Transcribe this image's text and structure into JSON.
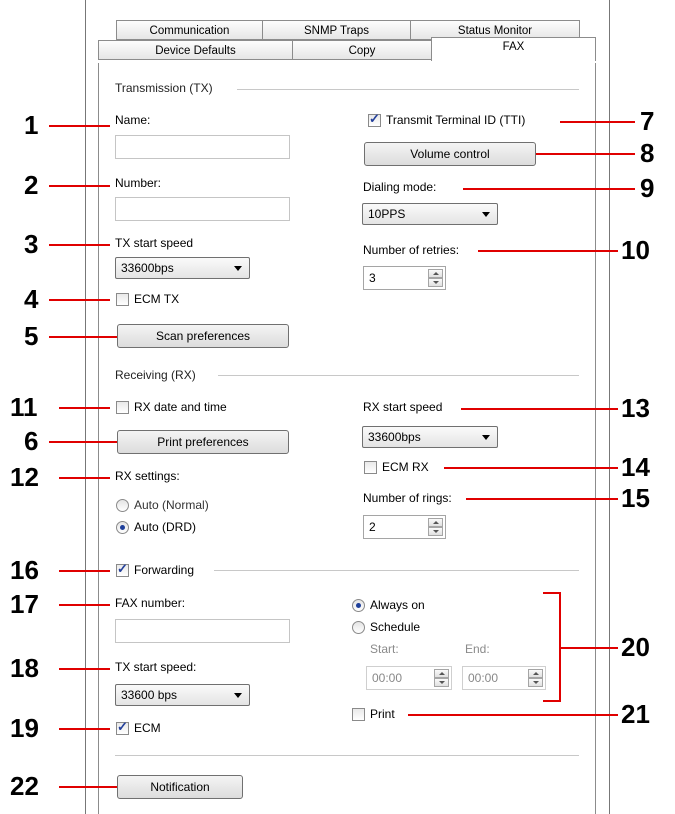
{
  "tabs": {
    "row1": [
      "Communication",
      "SNMP Traps",
      "Status Monitor"
    ],
    "row2": [
      "Device Defaults",
      "Copy",
      "FAX"
    ]
  },
  "tx": {
    "section": "Transmission (TX)",
    "name_label": "Name:",
    "number_label": "Number:",
    "start_speed_label": "TX start speed",
    "start_speed_value": "33600bps",
    "ecm_label": "ECM TX",
    "scan_button": "Scan preferences",
    "tti_label": "Transmit Terminal ID (TTI)",
    "volume_button": "Volume control",
    "dialing_label": "Dialing mode:",
    "dialing_value": "10PPS",
    "retries_label": "Number of retries:",
    "retries_value": "3"
  },
  "rx": {
    "section": "Receiving (RX)",
    "date_time_label": "RX date and time",
    "print_button": "Print preferences",
    "settings_label": "RX settings:",
    "auto_normal": "Auto (Normal)",
    "auto_drd": "Auto (DRD)",
    "start_speed_label": "RX start speed",
    "start_speed_value": "33600bps",
    "ecm_label": "ECM RX",
    "rings_label": "Number of rings:",
    "rings_value": "2"
  },
  "forwarding": {
    "label": "Forwarding",
    "fax_number_label": "FAX number:",
    "tx_speed_label": "TX start speed:",
    "tx_speed_value": "33600 bps",
    "ecm_label": "ECM",
    "always_on": "Always on",
    "schedule": "Schedule",
    "start_label": "Start:",
    "end_label": "End:",
    "start_value": "00:00",
    "end_value": "00:00",
    "print_label": "Print"
  },
  "notification_button": "Notification",
  "callouts": [
    "1",
    "2",
    "3",
    "4",
    "5",
    "6",
    "7",
    "8",
    "9",
    "10",
    "11",
    "12",
    "13",
    "14",
    "15",
    "16",
    "17",
    "18",
    "19",
    "20",
    "21",
    "22"
  ],
  "colors": {
    "callout_line": "#e00000",
    "check_mark": "#24409b",
    "radio_dot": "#1e3f9a"
  }
}
